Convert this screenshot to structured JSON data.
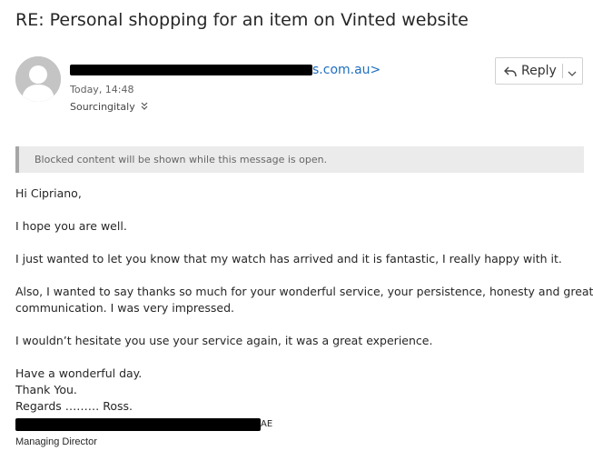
{
  "message": {
    "subject": "RE: Personal shopping for an item on Vinted website",
    "sender_visible_suffix": "s.com.au>",
    "date": "Today, 14:48",
    "recipient": "Sourcingitaly"
  },
  "actions": {
    "reply_label": "Reply"
  },
  "notice": {
    "blocked": "Blocked content will be shown while this message is open."
  },
  "body": {
    "lines": [
      "Hi Cipriano,",
      "I hope you are well.",
      "I just wanted to let you know that my watch has arrived and it is fantastic, I really happy with it.",
      "Also, I wanted to say thanks so much for your wonderful service, your persistence, honesty and great",
      "communication. I was very impressed.",
      "I wouldn’t hesitate you use your service again, it was a great experience.",
      "Have a wonderful day.",
      "Thank You.",
      "Regards ……… Ross."
    ]
  },
  "signature": {
    "name_suffix": "AE",
    "title": "Managing Director"
  },
  "icons": {
    "avatar": "person-icon",
    "reply": "reply-arrow-icon",
    "dropdown": "chevron-down-icon",
    "expand": "double-chevron-down-icon"
  },
  "colors": {
    "link": "#1f6fbf",
    "notice_bg": "#ebebeb",
    "notice_border": "#a6a6a6",
    "avatar_bg": "#c4c4c4"
  }
}
